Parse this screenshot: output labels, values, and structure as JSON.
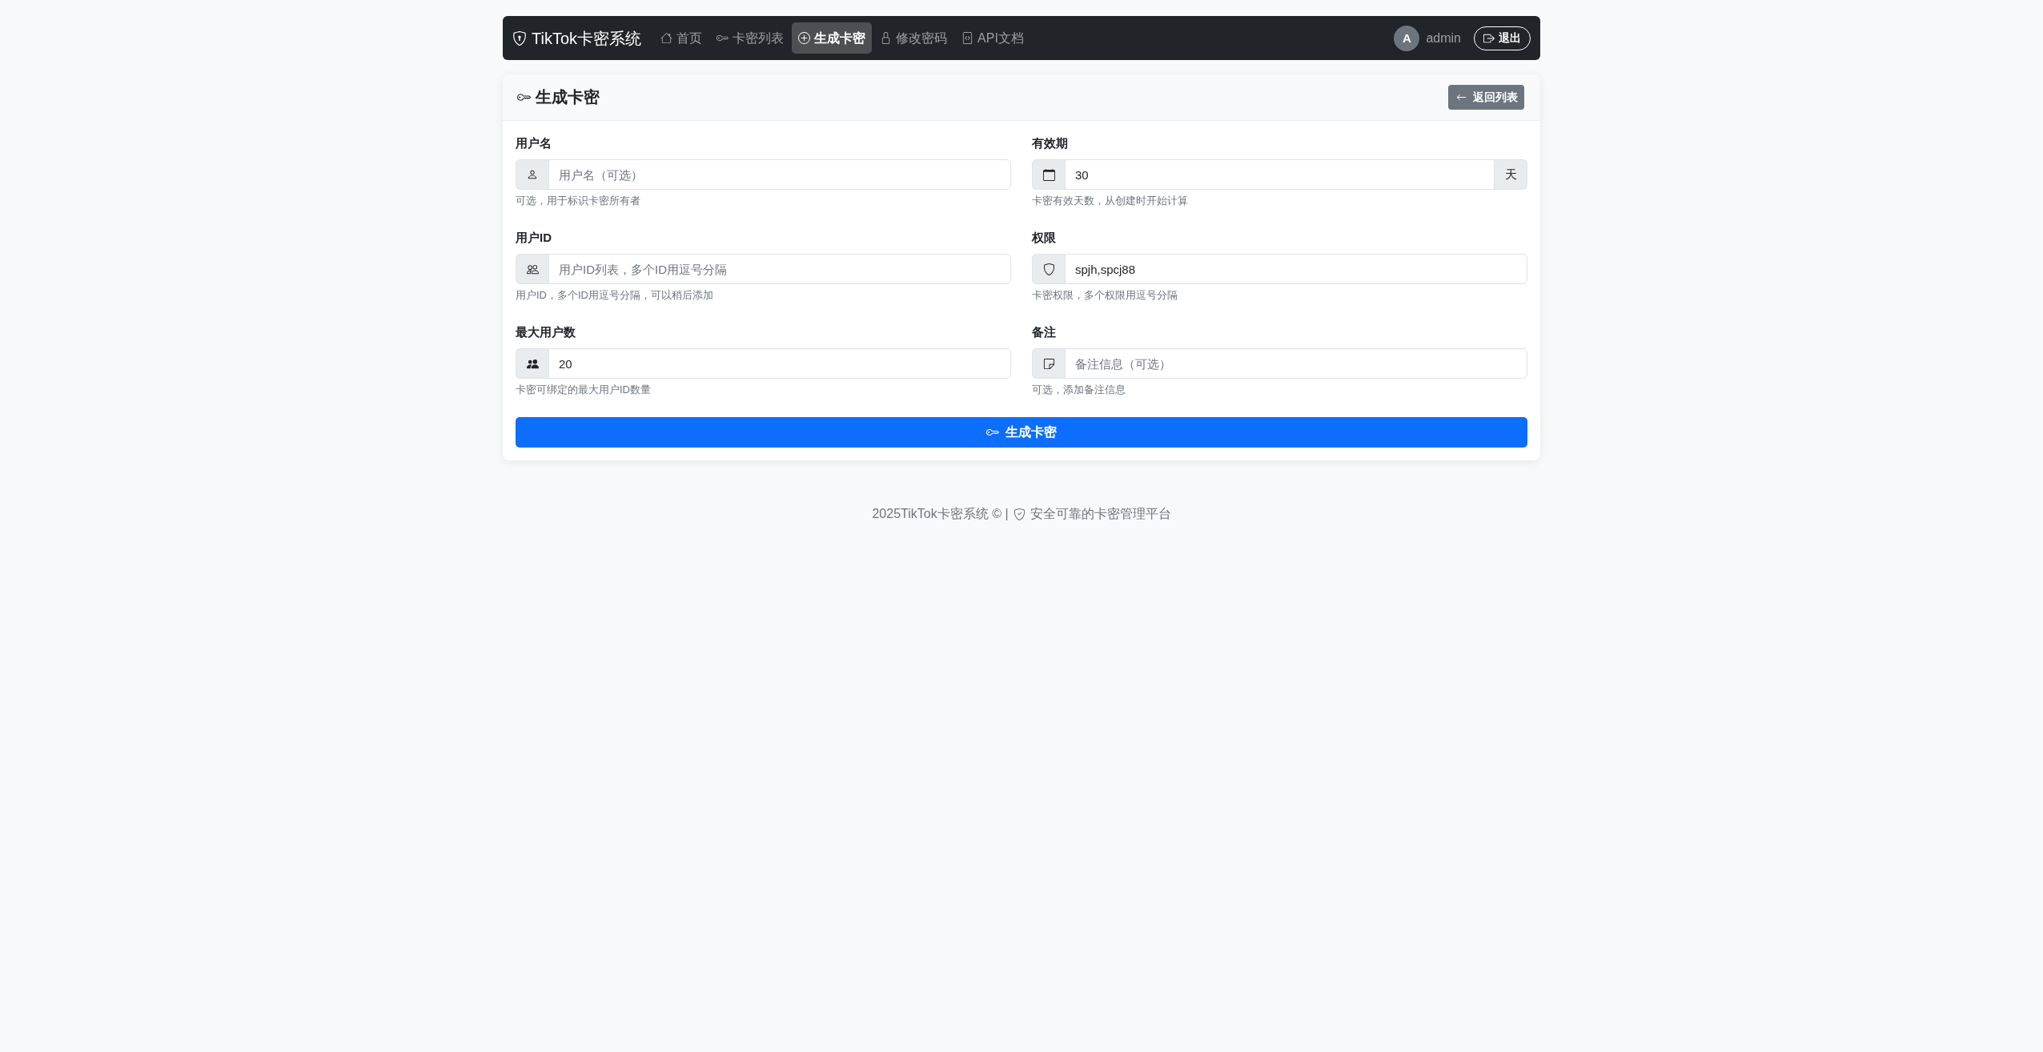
{
  "navbar": {
    "brand": "TikTok卡密系统",
    "links": [
      {
        "kind": "home",
        "label": "首页",
        "selected": false
      },
      {
        "kind": "list",
        "label": "卡密列表",
        "selected": false
      },
      {
        "kind": "create",
        "label": "生成卡密",
        "selected": true
      },
      {
        "kind": "password",
        "label": "修改密码",
        "selected": false
      },
      {
        "kind": "docs",
        "label": "API文档",
        "selected": false
      }
    ],
    "user": {
      "avatar_initial": "A",
      "name": "admin"
    },
    "logout_button": "退出"
  },
  "card": {
    "title": "生成卡密",
    "back_button": "返回列表",
    "fields": [
      {
        "kind": "username",
        "label": "用户名",
        "placeholder": "用户名（可选）",
        "help": "可选，用于标识卡密所有者"
      },
      {
        "kind": "validity",
        "label": "有效期",
        "value": "30",
        "suffix": "天",
        "help": "卡密有效天数，从创建时开始计算"
      },
      {
        "kind": "userids",
        "label": "用户ID",
        "placeholder": "用户ID列表，多个ID用逗号分隔",
        "help": "用户ID，多个ID用逗号分隔，可以稍后添加"
      },
      {
        "kind": "permissions",
        "label": "权限",
        "value": "spjh,spcj88",
        "help": "卡密权限，多个权限用逗号分隔"
      },
      {
        "kind": "maxusers",
        "label": "最大用户数",
        "value": "20",
        "help": "卡密可绑定的最大用户ID数量"
      },
      {
        "kind": "remark",
        "label": "备注",
        "placeholder": "备注信息（可选）",
        "help": "可选，添加备注信息"
      }
    ],
    "submit_button": "生成卡密"
  },
  "footer": {
    "copyright": "2025TikTok卡密系统 © |",
    "tagline": "安全可靠的卡密管理平台"
  }
}
